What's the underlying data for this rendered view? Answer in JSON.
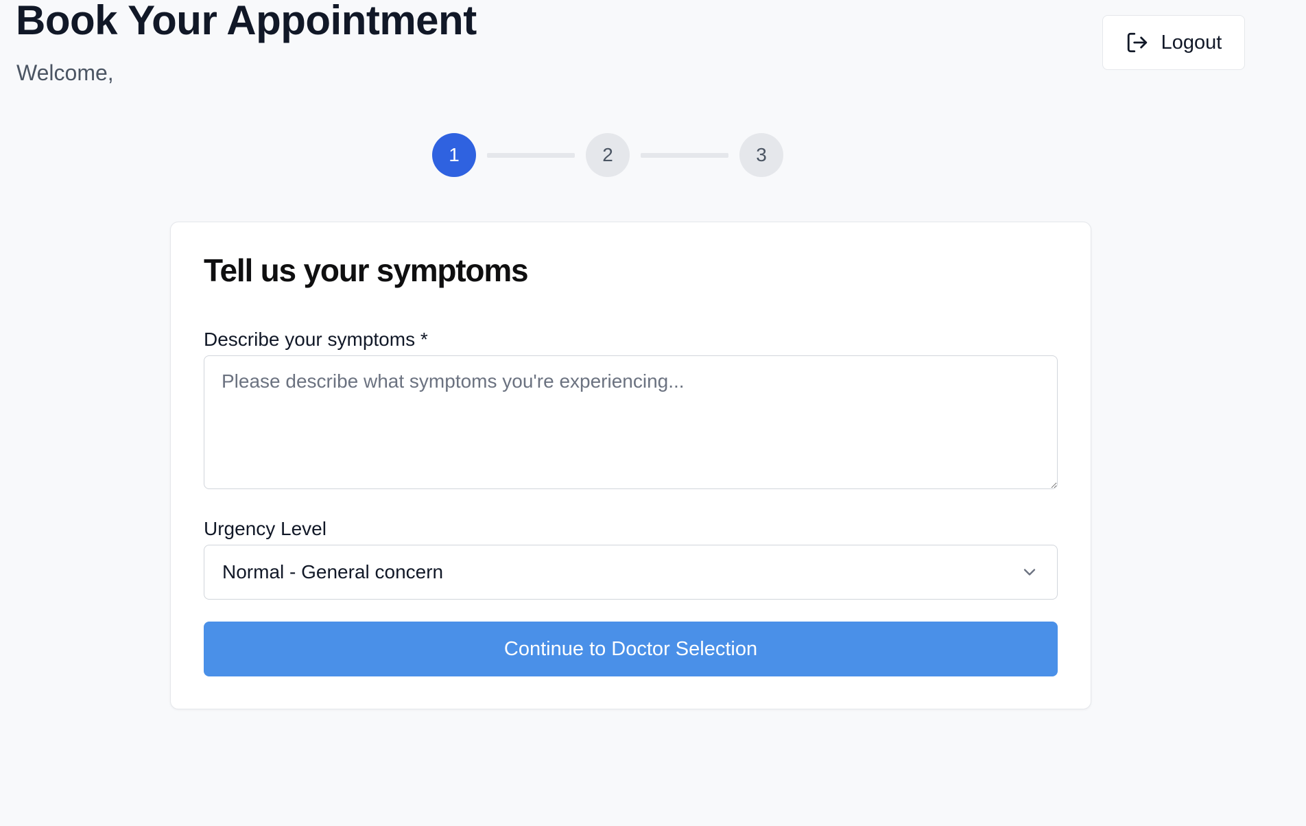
{
  "header": {
    "title": "Book Your Appointment",
    "welcome": "Welcome,",
    "logout_label": "Logout"
  },
  "stepper": {
    "steps": [
      "1",
      "2",
      "3"
    ],
    "current_step": 1
  },
  "form": {
    "title": "Tell us your symptoms",
    "symptoms_label": "Describe your symptoms *",
    "symptoms_placeholder": "Please describe what symptoms you're experiencing...",
    "symptoms_value": "",
    "urgency_label": "Urgency Level",
    "urgency_selected": "Normal - General concern",
    "continue_label": "Continue to Doctor Selection"
  },
  "colors": {
    "background": "#f8f9fb",
    "active_step": "#2f62e0",
    "primary_button": "#4a90e8",
    "inactive_step": "#e5e7eb"
  },
  "icons": {
    "logout": "logout-icon",
    "select": "chevron-down-icon"
  }
}
